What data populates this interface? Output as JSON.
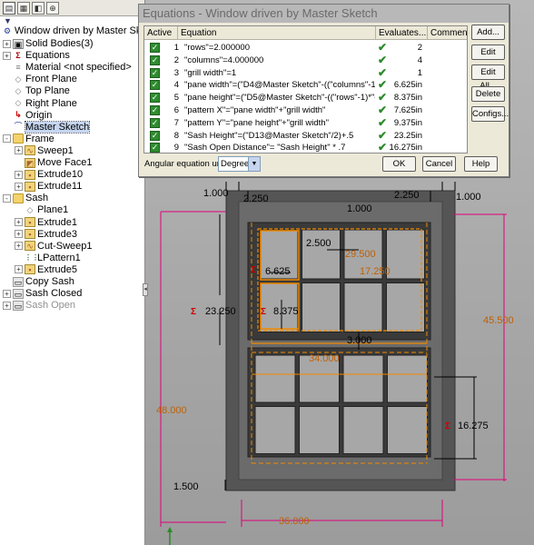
{
  "tree": {
    "tab_icons": [
      "feature-tree-tab-icon",
      "property-manager-tab-icon",
      "configuration-tab-icon",
      "dim-expert-tab-icon"
    ],
    "filter_icon": "filter-icon",
    "root": "Window driven by Master Sketch",
    "items": [
      {
        "label": "Solid Bodies(3)",
        "icon": "solid-bodies-icon",
        "indent": 1,
        "expander": "+"
      },
      {
        "label": "Equations",
        "icon": "equations-icon",
        "indent": 1,
        "expander": "+"
      },
      {
        "label": "Material <not specified>",
        "icon": "material-icon",
        "indent": 1,
        "expander": ""
      },
      {
        "label": "Front Plane",
        "icon": "plane-icon",
        "indent": 1,
        "expander": ""
      },
      {
        "label": "Top Plane",
        "icon": "plane-icon",
        "indent": 1,
        "expander": ""
      },
      {
        "label": "Right Plane",
        "icon": "plane-icon",
        "indent": 1,
        "expander": ""
      },
      {
        "label": "Origin",
        "icon": "origin-icon",
        "indent": 1,
        "expander": ""
      },
      {
        "label": "Master Sketch",
        "icon": "sketch-icon",
        "indent": 1,
        "expander": "",
        "selected": true
      },
      {
        "label": "Frame",
        "icon": "folder-icon",
        "indent": 1,
        "expander": "-"
      },
      {
        "label": "Sweep1",
        "icon": "sweep-icon",
        "indent": 2,
        "expander": "+"
      },
      {
        "label": "Move Face1",
        "icon": "move-face-icon",
        "indent": 2,
        "expander": ""
      },
      {
        "label": "Extrude10",
        "icon": "extrude-icon",
        "indent": 2,
        "expander": "+"
      },
      {
        "label": "Extrude11",
        "icon": "extrude-icon",
        "indent": 2,
        "expander": "+"
      },
      {
        "label": "Sash",
        "icon": "folder-icon",
        "indent": 1,
        "expander": "-"
      },
      {
        "label": "Plane1",
        "icon": "plane-icon",
        "indent": 2,
        "expander": ""
      },
      {
        "label": "Extrude1",
        "icon": "extrude-icon",
        "indent": 2,
        "expander": "+"
      },
      {
        "label": "Extrude3",
        "icon": "extrude-icon",
        "indent": 2,
        "expander": "+"
      },
      {
        "label": "Cut-Sweep1",
        "icon": "cut-sweep-icon",
        "indent": 2,
        "expander": "+"
      },
      {
        "label": "LPattern1",
        "icon": "linear-pattern-icon",
        "indent": 2,
        "expander": ""
      },
      {
        "label": "Extrude5",
        "icon": "extrude-icon",
        "indent": 2,
        "expander": "+"
      },
      {
        "label": "Copy Sash",
        "icon": "body-icon",
        "indent": 1,
        "expander": ""
      },
      {
        "label": "Sash Closed",
        "icon": "body-icon",
        "indent": 1,
        "expander": "+"
      },
      {
        "label": "Sash Open",
        "icon": "body-icon",
        "indent": 1,
        "expander": "+",
        "dimmed": true
      }
    ]
  },
  "dialog": {
    "title": "Equations - Window driven by Master Sketch",
    "columns": {
      "active": "Active",
      "equation": "Equation",
      "evaluates": "Evaluates...",
      "comment": "Comment"
    },
    "rows": [
      {
        "num": "1",
        "equation": "\"rows\"=2.000000",
        "value": "2"
      },
      {
        "num": "2",
        "equation": "\"columns\"=4.000000",
        "value": "4"
      },
      {
        "num": "3",
        "equation": "\"grill width\"=1",
        "value": "1"
      },
      {
        "num": "4",
        "equation": "\"pane width\"=(\"D4@Master Sketch\"-((\"columns\"-1)*\"...",
        "value": "6.625in"
      },
      {
        "num": "5",
        "equation": "\"pane height\"=(\"D5@Master Sketch\"-((\"rows\"-1)*\"grill...",
        "value": "8.375in"
      },
      {
        "num": "6",
        "equation": "\"pattern X\"=\"pane width\"+\"grill width\"",
        "value": "7.625in"
      },
      {
        "num": "7",
        "equation": "\"pattern Y\"=\"pane height\"+\"grill width\"",
        "value": "9.375in"
      },
      {
        "num": "8",
        "equation": "\"Sash Height\"=(\"D13@Master Sketch\"/2)+.5",
        "value": "23.25in"
      },
      {
        "num": "9",
        "equation": "\"Sash Open Distance\"= \"Sash Height\" * .7",
        "value": "16.275in"
      }
    ],
    "angle_label": "Angular equation unit",
    "angle_value": "Degrees",
    "buttons": {
      "add": "Add...",
      "edit": "Edit",
      "edit_all": "Edit All...",
      "delete": "Delete",
      "configs": "Configs...",
      "ok": "OK",
      "cancel": "Cancel",
      "help": "Help"
    }
  },
  "dimensions": {
    "d_1000_left": "1.000",
    "d_2250_left": "2.250",
    "d_1000_top": "1.000",
    "d_2250_right": "2.250",
    "d_1000_right": "1.000",
    "d_2500": "2.500",
    "d_29500": "29.500",
    "d_6625": "6.625",
    "d_17250": "17.250",
    "d_23250": "23.250",
    "d_8375": "8.375",
    "d_3000": "3.000",
    "d_34000": "34.000",
    "d_45500": "45.500",
    "d_48000": "48.000",
    "d_16275": "16.275",
    "d_1500": "1.500",
    "d_36000": "36.000",
    "equation_marker_symbol": "Σ"
  },
  "colors": {
    "dimension_text": "#000000",
    "driven_dimension": "#c06000",
    "extension_line": "#e0007a",
    "sketch_orange": "#f08a00",
    "check_green": "#2a8a2a"
  }
}
